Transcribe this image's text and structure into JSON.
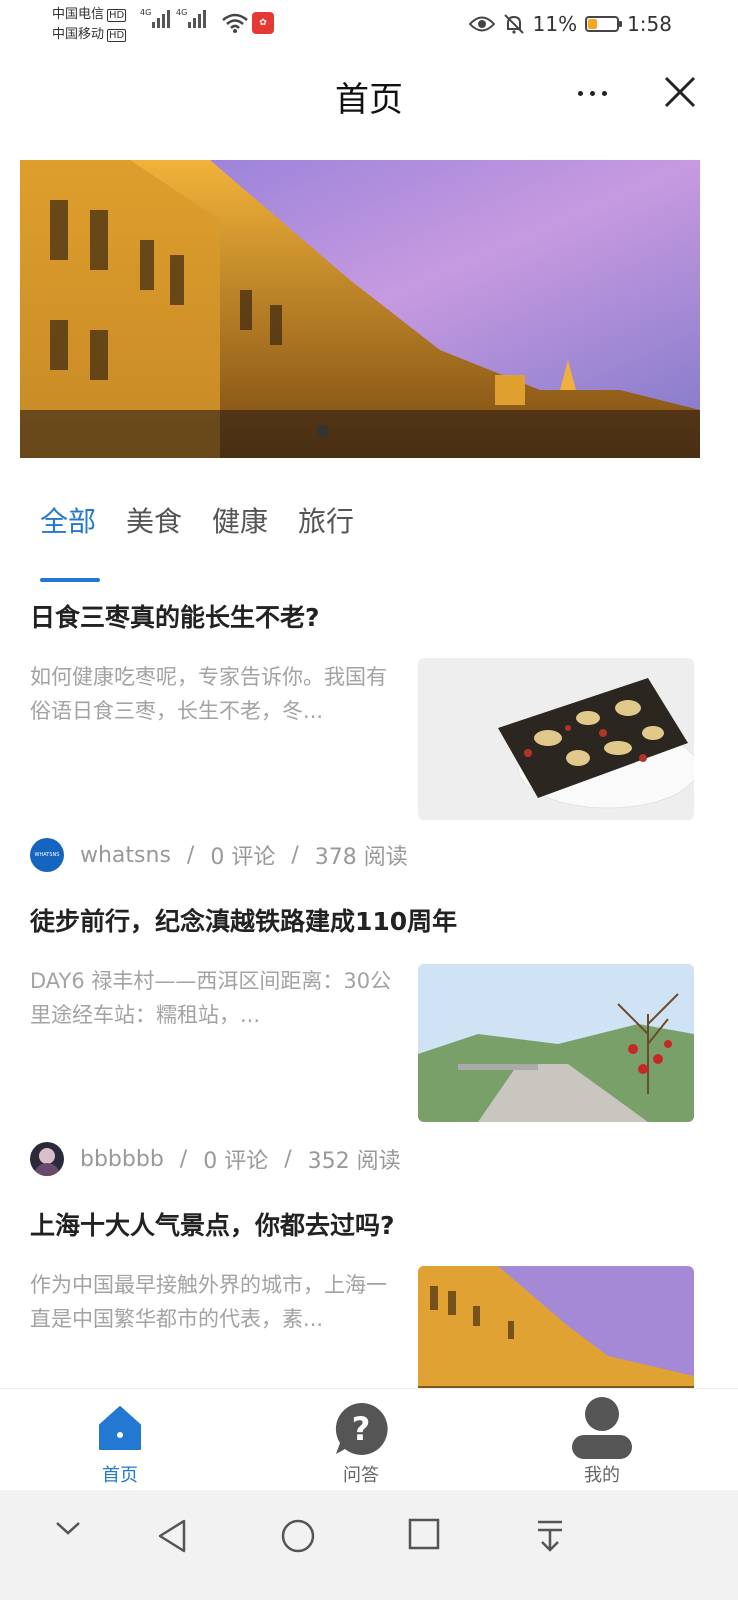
{
  "status_bar": {
    "carrier_1": "中国电信",
    "carrier_2": "中国移动",
    "hd": "HD",
    "network": "4G",
    "battery": "11%",
    "time": "1:58"
  },
  "header": {
    "title": "首页",
    "more_icon": "more-dots-icon",
    "close_icon": "close-icon"
  },
  "tabs": [
    {
      "label": "全部",
      "active": true
    },
    {
      "label": "美食",
      "active": false
    },
    {
      "label": "健康",
      "active": false
    },
    {
      "label": "旅行",
      "active": false
    }
  ],
  "articles": [
    {
      "title": "日食三枣真的能长生不老?",
      "summary": "如何健康吃枣呢，专家告诉你。我国有俗语日食三枣，长生不老，冬...",
      "author": "whatsns",
      "comments": "0 评论",
      "reads": "378 阅读",
      "avatar_text": "WHATSNS"
    },
    {
      "title": "徒步前行，纪念滇越铁路建成110周年",
      "summary": "DAY6 禄丰村——西洱区间距离：30公里途经车站：糯租站，...",
      "author": "bbbbbb",
      "comments": "0 评论",
      "reads": "352 阅读"
    },
    {
      "title": "上海十大人气景点，你都去过吗?",
      "summary": "作为中国最早接触外界的城市，上海一直是中国繁华都市的代表，素..."
    }
  ],
  "meta_separator": "/",
  "bottom_nav": [
    {
      "label": "首页",
      "icon": "home-icon",
      "active": true
    },
    {
      "label": "问答",
      "icon": "question-icon",
      "active": false
    },
    {
      "label": "我的",
      "icon": "user-icon",
      "active": false
    }
  ],
  "colors": {
    "accent": "#2379d2",
    "summary_text": "#a3a3a3",
    "meta_text": "#999999"
  }
}
